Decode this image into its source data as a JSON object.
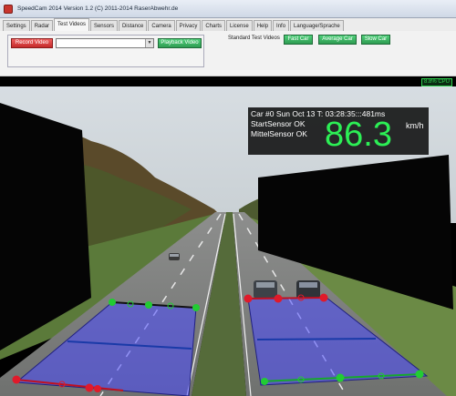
{
  "window": {
    "title": "SpeedCam 2014 Version 1.2 (C) 2011-2014 RaserAbwehr.de"
  },
  "tabs": [
    {
      "label": "Settings"
    },
    {
      "label": "Radar"
    },
    {
      "label": "Test Videos"
    },
    {
      "label": "Sensors"
    },
    {
      "label": "Distance"
    },
    {
      "label": "Camera"
    },
    {
      "label": "Privacy"
    },
    {
      "label": "Charts"
    },
    {
      "label": "License"
    },
    {
      "label": "Help"
    },
    {
      "label": "Info"
    },
    {
      "label": "Language/Sprache"
    }
  ],
  "active_tab": "Test Videos",
  "controls": {
    "record_label": "Record Video",
    "video_select_value": "",
    "playback_label": "Playback Video",
    "standard_videos_label": "Standard Test Videos",
    "fast_car_label": "Fast Car",
    "average_car_label": "Average Car",
    "slow_car_label": "Slow Car"
  },
  "status": {
    "cpu": "8.8% CPU"
  },
  "overlay": {
    "line1": "Car #0 Sun Oct 13 T: 03:28:35:::481ms",
    "line2": "StartSensor OK",
    "line3": "MittelSensor OK",
    "speed": "86.3",
    "unit": "km/h"
  },
  "colors": {
    "speed_green": "#2cef55",
    "record_red": "#d43a3a",
    "button_green": "#3cb463",
    "zone_fill": "#4a4aff",
    "marker_green": "#22cc33",
    "marker_red": "#e01a2a"
  }
}
